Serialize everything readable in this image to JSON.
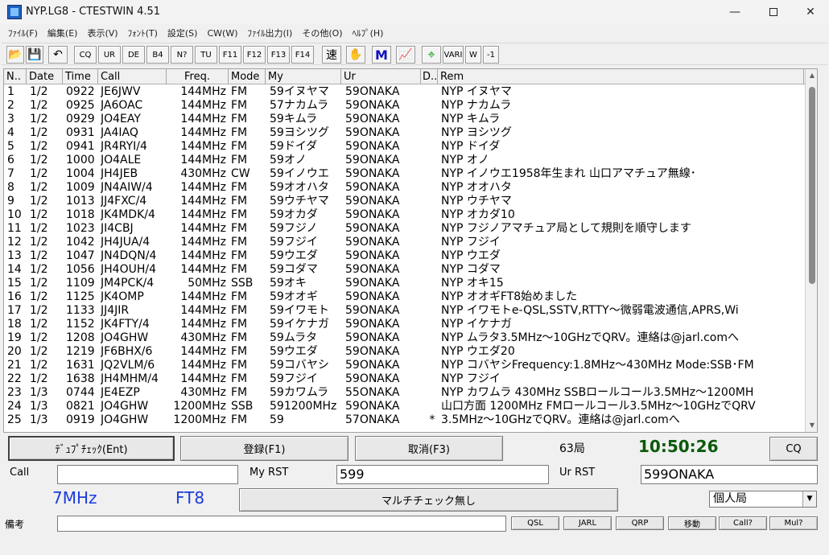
{
  "window": {
    "title": "NYP.LG8 - CTESTWIN 4.51",
    "min": "—",
    "close": "✕"
  },
  "menu": [
    "ﾌｧｲﾙ(F)",
    "編集(E)",
    "表示(V)",
    "ﾌｫﾝﾄ(T)",
    "設定(S)",
    "CW(W)",
    "ﾌｧｲﾙ出力(I)",
    "その他(O)",
    "ﾍﾙﾌﾟ(H)"
  ],
  "toolbar": {
    "open_icon": "folder-open-icon",
    "save_icon": "floppy-icon",
    "undo_icon": "undo-icon",
    "cq": "CQ",
    "ur": "UR",
    "de": "DE",
    "b4": "B4",
    "nq": "N?",
    "tu": "TU",
    "f11": "F11",
    "f12": "F12",
    "f13": "F13",
    "f14": "F14",
    "speed": "速",
    "hand": "✋",
    "m": "M",
    "chart": "📈",
    "target": "⌖",
    "vari": "VARI",
    "w": "W",
    "minus1": "-1"
  },
  "grid": {
    "headers": [
      "N..",
      "Date",
      "Time",
      "Call",
      "Freq.",
      "Mode",
      "My",
      "Ur",
      "D..",
      "Rem"
    ],
    "rows": [
      [
        "1",
        "1/2",
        "0922",
        "JE6JWV",
        "144MHz",
        "FM",
        "59イヌヤマ",
        "59ONAKA",
        "",
        "NYP イヌヤマ"
      ],
      [
        "2",
        "1/2",
        "0925",
        "JA6OAC",
        "144MHz",
        "FM",
        "57ナカムラ",
        "59ONAKA",
        "",
        "NYP ナカムラ"
      ],
      [
        "3",
        "1/2",
        "0929",
        "JO4EAY",
        "144MHz",
        "FM",
        "59キムラ",
        "59ONAKA",
        "",
        "NYP キムラ"
      ],
      [
        "4",
        "1/2",
        "0931",
        "JA4IAQ",
        "144MHz",
        "FM",
        "59ヨシツグ",
        "59ONAKA",
        "",
        "NYP ヨシツグ"
      ],
      [
        "5",
        "1/2",
        "0941",
        "JR4RYI/4",
        "144MHz",
        "FM",
        "59ドイダ",
        "59ONAKA",
        "",
        "NYP ドイダ"
      ],
      [
        "6",
        "1/2",
        "1000",
        "JO4ALE",
        "144MHz",
        "FM",
        "59オノ",
        "59ONAKA",
        "",
        "NYP オノ"
      ],
      [
        "7",
        "1/2",
        "1004",
        "JH4JEB",
        "430MHz",
        "CW",
        "59イノウエ",
        "59ONAKA",
        "",
        "NYP イノウエ1958年生まれ 山口アマチュア無線･"
      ],
      [
        "8",
        "1/2",
        "1009",
        "JN4AIW/4",
        "144MHz",
        "FM",
        "59オオハタ",
        "59ONAKA",
        "",
        "NYP オオハタ"
      ],
      [
        "9",
        "1/2",
        "1013",
        "JJ4FXC/4",
        "144MHz",
        "FM",
        "59ウチヤマ",
        "59ONAKA",
        "",
        "NYP ウチヤマ"
      ],
      [
        "10",
        "1/2",
        "1018",
        "JK4MDK/4",
        "144MHz",
        "FM",
        "59オカダ",
        "59ONAKA",
        "",
        "NYP オカダ10"
      ],
      [
        "11",
        "1/2",
        "1023",
        "JI4CBJ",
        "144MHz",
        "FM",
        "59フジノ",
        "59ONAKA",
        "",
        "NYP フジノアマチュア局として規則を順守します"
      ],
      [
        "12",
        "1/2",
        "1042",
        "JH4JUA/4",
        "144MHz",
        "FM",
        "59フジイ",
        "59ONAKA",
        "",
        "NYP フジイ"
      ],
      [
        "13",
        "1/2",
        "1047",
        "JN4DQN/4",
        "144MHz",
        "FM",
        "59ウエダ",
        "59ONAKA",
        "",
        "NYP ウエダ"
      ],
      [
        "14",
        "1/2",
        "1056",
        "JH4OUH/4",
        "144MHz",
        "FM",
        "59コダマ",
        "59ONAKA",
        "",
        "NYP コダマ"
      ],
      [
        "15",
        "1/2",
        "1109",
        "JM4PCK/4",
        "50MHz",
        "SSB",
        "59オキ",
        "59ONAKA",
        "",
        "NYP オキ15"
      ],
      [
        "16",
        "1/2",
        "1125",
        "JK4OMP",
        "144MHz",
        "FM",
        "59オオギ",
        "59ONAKA",
        "",
        "NYP オオギFT8始めました"
      ],
      [
        "17",
        "1/2",
        "1133",
        "JJ4JIR",
        "144MHz",
        "FM",
        "59イワモト",
        "59ONAKA",
        "",
        "NYP イワモトe-QSL,SSTV,RTTY〜微弱電波通信,APRS,Wi"
      ],
      [
        "18",
        "1/2",
        "1152",
        "JK4FTY/4",
        "144MHz",
        "FM",
        "59イケナガ",
        "59ONAKA",
        "",
        "NYP イケナガ"
      ],
      [
        "19",
        "1/2",
        "1208",
        "JO4GHW",
        "430MHz",
        "FM",
        "59ムラタ",
        "59ONAKA",
        "",
        "NYP ムラタ3.5MHz〜10GHzでQRV。連絡は@jarl.comへ"
      ],
      [
        "20",
        "1/2",
        "1219",
        "JF6BHX/6",
        "144MHz",
        "FM",
        "59ウエダ",
        "59ONAKA",
        "",
        "NYP ウエダ20"
      ],
      [
        "21",
        "1/2",
        "1631",
        "JQ2VLM/6",
        "144MHz",
        "FM",
        "59コバヤシ",
        "59ONAKA",
        "",
        "NYP コバヤシFrequency:1.8MHz〜430MHz Mode:SSB･FM"
      ],
      [
        "22",
        "1/2",
        "1638",
        "JH4MHM/4",
        "144MHz",
        "FM",
        "59フジイ",
        "59ONAKA",
        "",
        "NYP フジイ"
      ],
      [
        "23",
        "1/3",
        "0744",
        "JE4EZP",
        "430MHz",
        "FM",
        "59カワムラ",
        "55ONAKA",
        "",
        "NYP カワムラ 430MHz SSBロールコール3.5MHz〜1200MH"
      ],
      [
        "24",
        "1/3",
        "0821",
        "JO4GHW",
        "1200MHz",
        "SSB",
        "591200MHz",
        "59ONAKA",
        "",
        "山口方面 1200MHz FMロールコール3.5MHz〜10GHzでQRV"
      ],
      [
        "25",
        "1/3",
        "0919",
        "JO4GHW",
        "1200MHz",
        "FM",
        "59",
        "57ONAKA",
        "*",
        "3.5MHz〜10GHzでQRV。連絡は@jarl.comへ"
      ]
    ]
  },
  "bottom": {
    "dupe_check": "ﾃﾞｭﾌﾟﾁｪｯｸ(Ent)",
    "register": "登録(F1)",
    "cancel": "取消(F3)",
    "qso_count": "63局",
    "clock": "10:50:26",
    "cq": "CQ",
    "call_label": "Call",
    "call_value": "",
    "my_rst_label": "My RST",
    "my_rst_value": "599",
    "ur_rst_label": "Ur RST",
    "ur_rst_value": "599ONAKA",
    "band": "7MHz",
    "mode": "FT8",
    "multi_check": "マルチチェック無し",
    "station_type": "個人局",
    "remarks_label": "備考",
    "remarks_value": "",
    "qsl": "QSL",
    "jarl": "JARL",
    "qrp": "QRP",
    "move": "移動",
    "call_q": "Call?",
    "mul_q": "Mul?"
  }
}
